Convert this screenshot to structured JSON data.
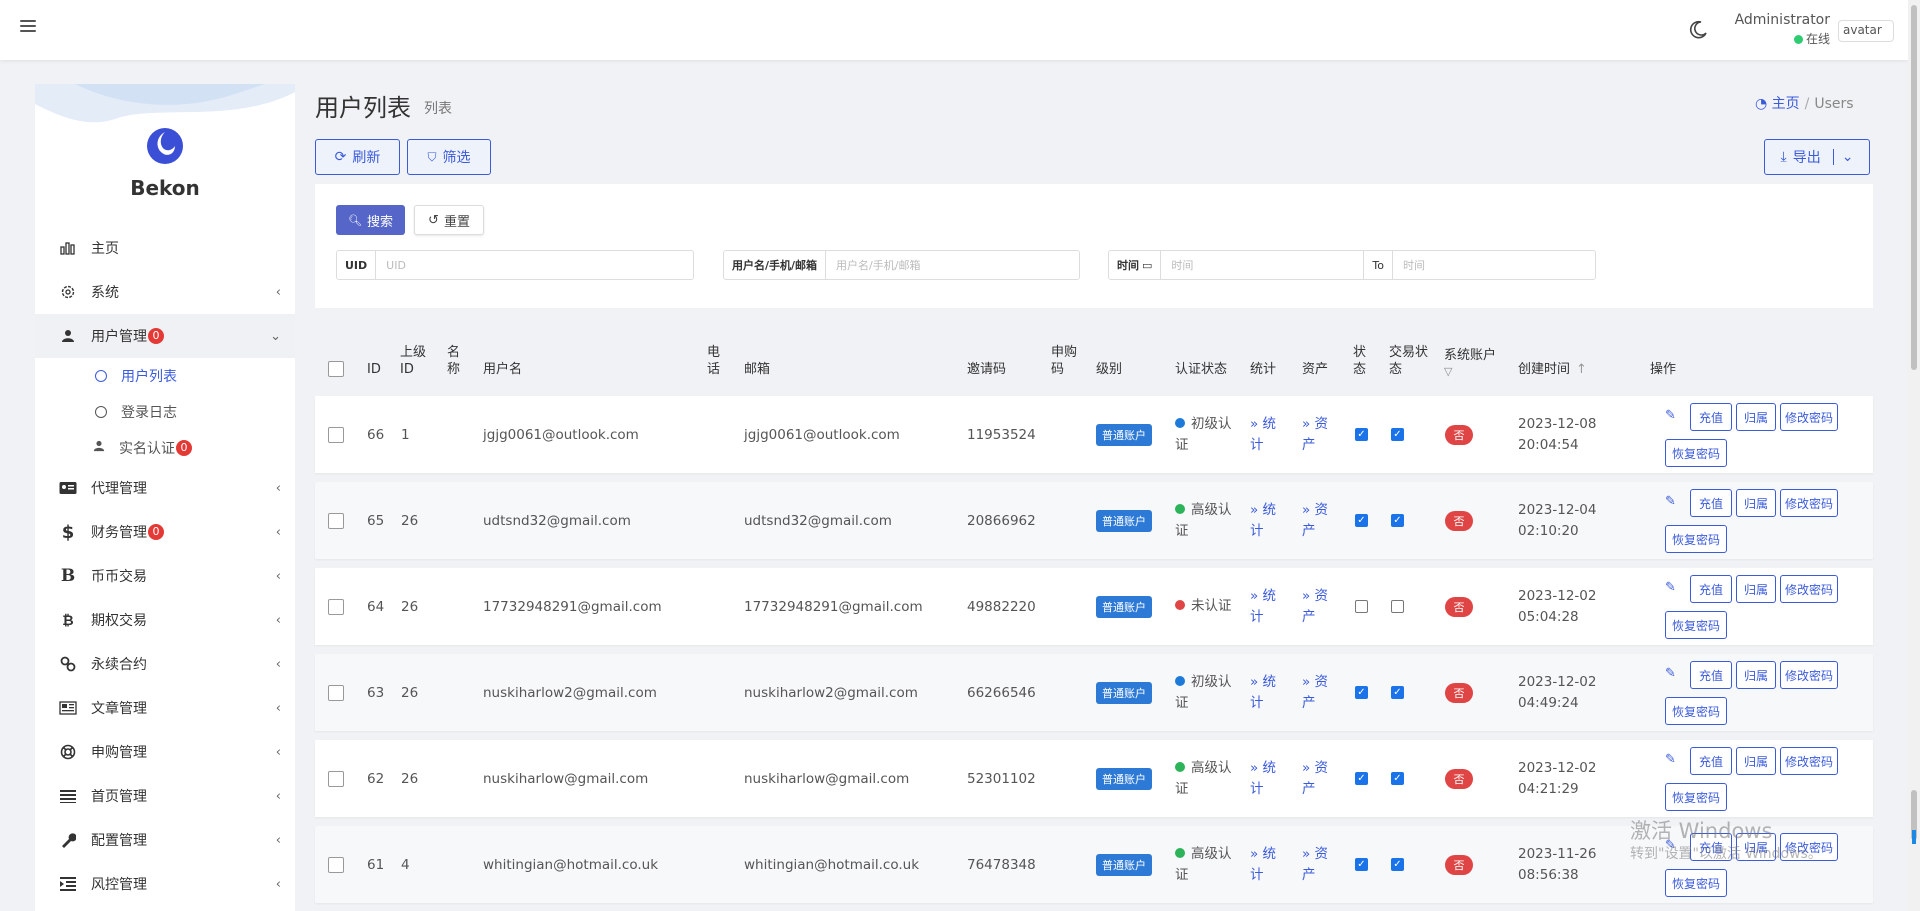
{
  "topbar": {
    "admin_name": "Administrator",
    "status_text": "在线",
    "avatar_alt": "avatar"
  },
  "sidebar": {
    "brand": "Bekon",
    "items": [
      {
        "label": "主页",
        "icon": "bar-chart-icon",
        "badge": null,
        "chevron": false
      },
      {
        "label": "系统",
        "icon": "gear-icon",
        "badge": null,
        "chevron": true
      },
      {
        "label": "用户管理",
        "icon": "user-tie-icon",
        "badge": "0",
        "chevron": true,
        "expanded": true
      },
      {
        "label": "代理管理",
        "icon": "id-card-icon",
        "badge": null,
        "chevron": true
      },
      {
        "label": "财务管理",
        "icon": "dollar-icon",
        "badge": "0",
        "chevron": true
      },
      {
        "label": "币币交易",
        "icon": "bold-b-icon",
        "badge": null,
        "chevron": true
      },
      {
        "label": "期权交易",
        "icon": "bitcoin-icon",
        "badge": null,
        "chevron": true
      },
      {
        "label": "永续合约",
        "icon": "link-icon",
        "badge": null,
        "chevron": true
      },
      {
        "label": "文章管理",
        "icon": "newspaper-icon",
        "badge": null,
        "chevron": true
      },
      {
        "label": "申购管理",
        "icon": "life-ring-icon",
        "badge": null,
        "chevron": true
      },
      {
        "label": "首页管理",
        "icon": "list-icon",
        "badge": null,
        "chevron": true
      },
      {
        "label": "配置管理",
        "icon": "wrench-icon",
        "badge": null,
        "chevron": true
      },
      {
        "label": "风控管理",
        "icon": "outdent-icon",
        "badge": null,
        "chevron": true
      }
    ],
    "subitems": [
      {
        "label": "用户列表",
        "active": true
      },
      {
        "label": "登录日志",
        "active": false
      },
      {
        "label": "实名认证",
        "badge": "0",
        "active": false
      }
    ]
  },
  "page": {
    "title": "用户列表",
    "subtitle": "列表",
    "breadcrumb_home": "主页",
    "breadcrumb_current": "Users",
    "refresh_label": "刷新",
    "filter_label": "筛选",
    "export_label": "导出"
  },
  "filter": {
    "search_label": "搜索",
    "reset_label": "重置",
    "uid_label": "UID",
    "uid_placeholder": "UID",
    "user_label": "用户名/手机/邮箱",
    "user_placeholder": "用户名/手机/邮箱",
    "time_label": "时间",
    "time_placeholder": "时间",
    "to_label": "To",
    "to_placeholder": "时间"
  },
  "table": {
    "headers": {
      "id": "ID",
      "parent_id": "上级ID",
      "name": "名称",
      "username": "用户名",
      "phone": "电话",
      "email": "邮箱",
      "invite": "邀请码",
      "apply_code": "申购码",
      "level": "级别",
      "auth": "认证状态",
      "stats": "统计",
      "assets": "资产",
      "status": "状态",
      "trade_status": "交易状态",
      "system_account": "系统账户",
      "created": "创建时间",
      "actions": "操作"
    },
    "actions": {
      "recharge": "充值",
      "owner": "归属",
      "change_pwd": "修改密码",
      "reset_pwd": "恢复密码"
    },
    "stats_link": "» 统计",
    "assets_link": "» 资产",
    "rows": [
      {
        "id": "66",
        "parent_id": "1",
        "username": "jgjg0061@outlook.com",
        "email": "jgjg0061@outlook.com",
        "invite": "11953524",
        "level": "普通账户",
        "auth": "初级认证",
        "auth_color": "#1e7ad8",
        "status": true,
        "trade": true,
        "system": "否",
        "created": [
          "2023-12-08",
          "20:04:54"
        ]
      },
      {
        "id": "65",
        "parent_id": "26",
        "username": "udtsnd32@gmail.com",
        "email": "udtsnd32@gmail.com",
        "invite": "20866962",
        "level": "普通账户",
        "auth": "高级认证",
        "auth_color": "#2db35a",
        "status": true,
        "trade": true,
        "system": "否",
        "created": [
          "2023-12-04",
          "02:10:20"
        ]
      },
      {
        "id": "64",
        "parent_id": "26",
        "username": "17732948291@gmail.com",
        "email": "17732948291@gmail.com",
        "invite": "49882220",
        "level": "普通账户",
        "auth": "未认证",
        "auth_color": "#e04545",
        "status": false,
        "trade": false,
        "system": "否",
        "created": [
          "2023-12-02",
          "05:04:28"
        ]
      },
      {
        "id": "63",
        "parent_id": "26",
        "username": "nuskiharlow2@gmail.com",
        "email": "nuskiharlow2@gmail.com",
        "invite": "66266546",
        "level": "普通账户",
        "auth": "初级认证",
        "auth_color": "#1e7ad8",
        "status": true,
        "trade": true,
        "system": "否",
        "created": [
          "2023-12-02",
          "04:49:24"
        ]
      },
      {
        "id": "62",
        "parent_id": "26",
        "username": "nuskiharlow@gmail.com",
        "email": "nuskiharlow@gmail.com",
        "invite": "52301102",
        "level": "普通账户",
        "auth": "高级认证",
        "auth_color": "#2db35a",
        "status": true,
        "trade": true,
        "system": "否",
        "created": [
          "2023-12-02",
          "04:21:29"
        ]
      },
      {
        "id": "61",
        "parent_id": "4",
        "username": "whitingian@hotmail.co.uk",
        "email": "whitingian@hotmail.co.uk",
        "invite": "76478348",
        "level": "普通账户",
        "auth": "高级认证",
        "auth_color": "#2db35a",
        "status": true,
        "trade": true,
        "system": "否",
        "created": [
          "2023-11-26",
          "08:56:38"
        ]
      }
    ]
  },
  "watermark": {
    "line1": "激活 Windows",
    "line2": "转到\"设置\"以激活 Windows。"
  }
}
